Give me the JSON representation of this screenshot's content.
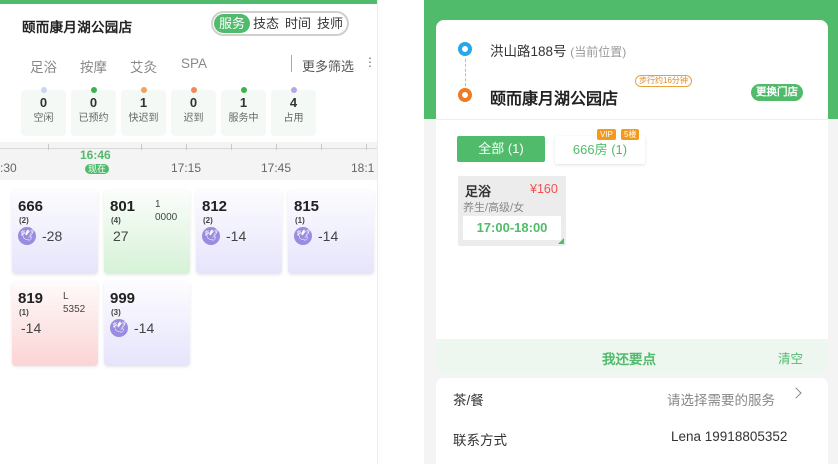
{
  "left": {
    "store_name": "颐而康月湖公园店",
    "seg_tabs": [
      "服务",
      "技态",
      "时间",
      "技师"
    ],
    "sub_tabs": [
      "足浴",
      "按摩",
      "艾灸",
      "SPA"
    ],
    "more_filter": "更多筛选",
    "more_icon": "⋮",
    "stats": [
      {
        "num": "0",
        "label": "空闲",
        "color": "#c9d6f0"
      },
      {
        "num": "0",
        "label": "已预约",
        "color": "#3cb44b"
      },
      {
        "num": "1",
        "label": "快迟到",
        "color": "#f2a35d"
      },
      {
        "num": "0",
        "label": "迟到",
        "color": "#f28a5a"
      },
      {
        "num": "1",
        "label": "服务中",
        "color": "#3cb44b"
      },
      {
        "num": "4",
        "label": "占用",
        "color": "#b6a6e6"
      }
    ],
    "timeline": {
      "labels": [
        ":30",
        "17:15",
        "17:45",
        "18:1"
      ],
      "now_time": "16:46",
      "now_badge": "现在"
    },
    "rooms": [
      {
        "no": "666",
        "count": "(2)",
        "value": "-28",
        "icon": "🕊",
        "top": ""
      },
      {
        "no": "801",
        "count": "(4)",
        "value": "27",
        "icon": "",
        "top_a": "1",
        "top_b": "0000"
      },
      {
        "no": "812",
        "count": "(2)",
        "value": "-14",
        "icon": "🕊"
      },
      {
        "no": "815",
        "count": "(1)",
        "value": "-14",
        "icon": "🕊"
      },
      {
        "no": "819",
        "count": "(1)",
        "value": "-14",
        "icon": "",
        "top_a": "L",
        "top_b": "5352"
      },
      {
        "no": "999",
        "count": "(3)",
        "value": "-14",
        "icon": "🕊"
      }
    ]
  },
  "right": {
    "current_addr": "洪山路188号",
    "current_tag": "(当前位置)",
    "store": "颐而康月湖公园店",
    "walk": "步行约16分钟",
    "change_store": "更换门店",
    "tab_all": "全部 (1)",
    "tab_room": "666房 (1)",
    "vip": "VIP",
    "floor": "5楼",
    "service": {
      "name": "足浴",
      "price": "¥160",
      "desc": "养生/高级/女",
      "time": "17:00-18:00"
    },
    "want_more": "我还要点",
    "clear": "清空",
    "tea_label": "茶/餐",
    "tea_value": "请选择需要的服务",
    "contact_label": "联系方式",
    "contact_value": "Lena 19918805352"
  }
}
